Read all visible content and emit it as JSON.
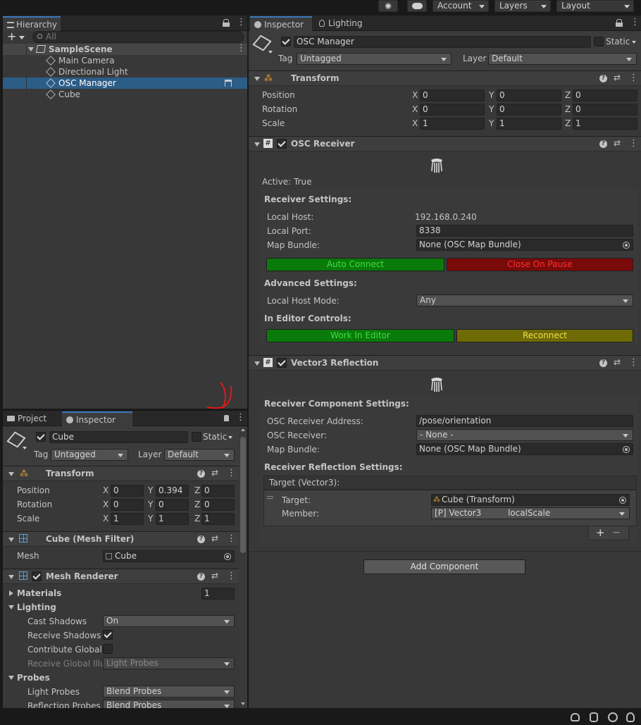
{
  "toolbar": {
    "account": "Account",
    "layers": "Layers",
    "layout": "Layout"
  },
  "hierarchy": {
    "tab": "Hierarchy",
    "search_placeholder": "All",
    "scene": "SampleScene",
    "items": [
      "Main Camera",
      "Directional Light",
      "OSC Manager",
      "Cube"
    ]
  },
  "bottom_tabs": {
    "project": "Project",
    "inspector": "Inspector"
  },
  "cube_inspector": {
    "name": "Cube",
    "static": "Static",
    "tag_label": "Tag",
    "tag": "Untagged",
    "layer_label": "Layer",
    "layer": "Default",
    "transform": {
      "title": "Transform",
      "position_label": "Position",
      "rotation_label": "Rotation",
      "scale_label": "Scale",
      "x": "X",
      "y": "Y",
      "z": "Z",
      "position": [
        "0",
        "0.394",
        "0"
      ],
      "rotation": [
        "0",
        "0",
        "0"
      ],
      "scale": [
        "1",
        "1",
        "1"
      ]
    },
    "mesh_filter": {
      "title": "Cube (Mesh Filter)",
      "mesh_label": "Mesh",
      "mesh": "Cube"
    },
    "mesh_renderer": {
      "title": "Mesh Renderer",
      "materials_label": "Materials",
      "materials_count": "1",
      "lighting_label": "Lighting",
      "cast_shadows_label": "Cast Shadows",
      "cast_shadows": "On",
      "receive_shadows_label": "Receive Shadows",
      "contribute_gi_label": "Contribute Global I",
      "receive_gi_label": "Receive Global Illu",
      "receive_gi": "Light Probes",
      "probes_label": "Probes",
      "light_probes_label": "Light Probes",
      "light_probes": "Blend Probes",
      "reflection_probes_label": "Reflection Probes",
      "reflection_probes": "Blend Probes"
    }
  },
  "inspector": {
    "tab_inspector": "Inspector",
    "tab_lighting": "Lighting",
    "name": "OSC Manager",
    "static": "Static",
    "tag_label": "Tag",
    "tag": "Untagged",
    "layer_label": "Layer",
    "layer": "Default",
    "transform": {
      "title": "Transform",
      "position_label": "Position",
      "rotation_label": "Rotation",
      "scale_label": "Scale",
      "x": "X",
      "y": "Y",
      "z": "Z",
      "position": [
        "0",
        "0",
        "0"
      ],
      "rotation": [
        "0",
        "0",
        "0"
      ],
      "scale": [
        "1",
        "1",
        "1"
      ]
    },
    "osc_receiver": {
      "title": "OSC Receiver",
      "active": "Active: True",
      "receiver_settings": "Receiver Settings:",
      "local_host_label": "Local Host:",
      "local_host": "192.168.0.240",
      "local_port_label": "Local Port:",
      "local_port": "8338",
      "map_bundle_label": "Map Bundle:",
      "map_bundle": "None (OSC Map Bundle)",
      "auto_connect": "Auto Connect",
      "close_on_pause": "Close On Pause",
      "advanced_settings": "Advanced Settings:",
      "local_host_mode_label": "Local Host Mode:",
      "local_host_mode": "Any",
      "in_editor_controls": "In Editor Controls:",
      "work_in_editor": "Work In Editor",
      "reconnect": "Reconnect"
    },
    "vector3_reflection": {
      "title": "Vector3 Reflection",
      "receiver_component_settings": "Receiver Component Settings:",
      "address_label": "OSC Receiver Address:",
      "address": "/pose/orientation",
      "osc_receiver_label": "OSC Receiver:",
      "osc_receiver": "- None -",
      "map_bundle_label": "Map Bundle:",
      "map_bundle": "None (OSC Map Bundle)",
      "reflection_settings": "Receiver Reflection Settings:",
      "target_list_header": "Target (Vector3):",
      "target_label": "Target:",
      "target": "Cube (Transform)",
      "member_label": "Member:",
      "member_type": "[P] Vector3",
      "member": "localScale",
      "plus": "+",
      "minus": "−"
    },
    "add_component": "Add Component"
  },
  "colors": {
    "accent": "#3a79bb",
    "selection": "#2c5d87",
    "green": "#0a7a0a",
    "red": "#7a0a0a",
    "olive": "#6e6b05"
  }
}
